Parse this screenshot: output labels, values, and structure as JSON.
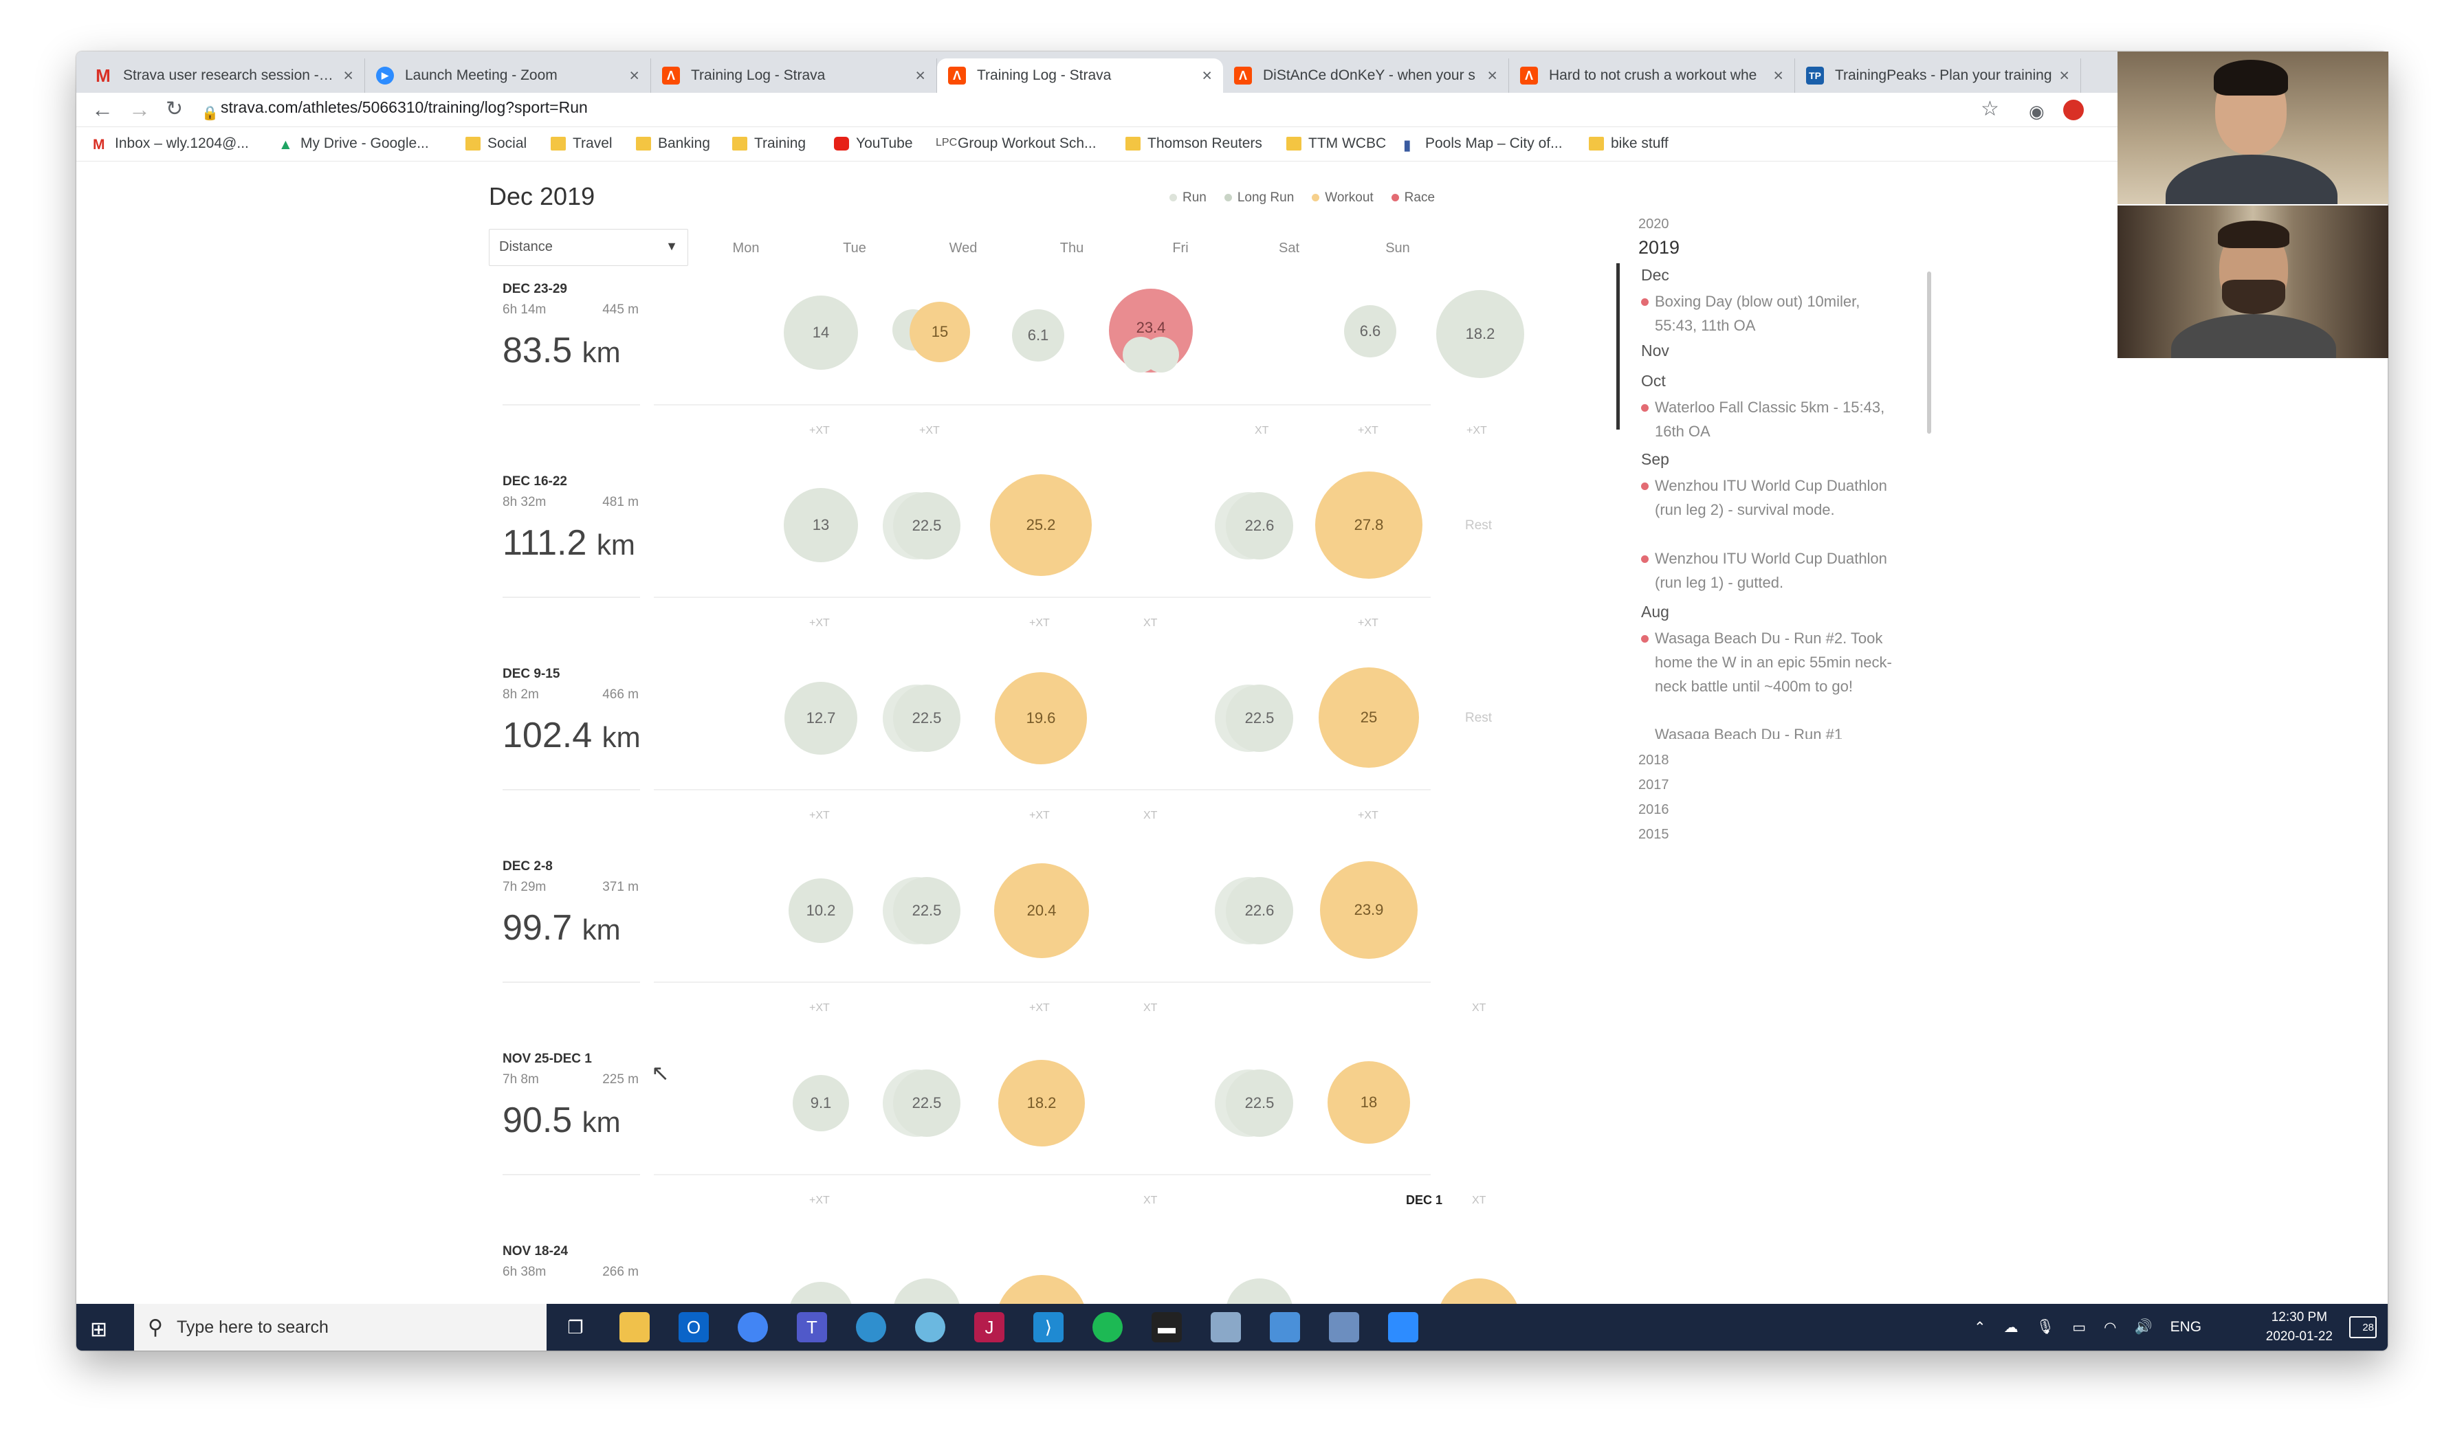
{
  "browser": {
    "tabs": [
      {
        "title": "Strava user research session - Co",
        "icon": "gmail-icon",
        "color": "#d93025",
        "glyph": "M"
      },
      {
        "title": "Launch Meeting - Zoom",
        "icon": "zoom-icon",
        "color": "#2d8cff",
        "glyph": "▶"
      },
      {
        "title": "Training Log - Strava",
        "icon": "strava-icon",
        "color": "#fc4c02",
        "glyph": "Λ"
      },
      {
        "title": "Training Log - Strava",
        "icon": "strava-icon",
        "color": "#fc4c02",
        "glyph": "Λ",
        "active": true
      },
      {
        "title": "DiStAnCe dOnKeY - when your s",
        "icon": "strava-icon",
        "color": "#fc4c02",
        "glyph": "Λ"
      },
      {
        "title": "Hard to not crush a workout whe",
        "icon": "strava-icon",
        "color": "#fc4c02",
        "glyph": "Λ"
      },
      {
        "title": "TrainingPeaks - Plan your training",
        "icon": "trainingpeaks-icon",
        "color": "#1a5faa",
        "glyph": "TP"
      }
    ],
    "close_glyph": "×",
    "url": "strava.com/athletes/5066310/training/log?sport=Run",
    "bookmarks": [
      "Inbox – wly.1204@...",
      "My Drive - Google...",
      "Social",
      "Travel",
      "Banking",
      "Training",
      "YouTube",
      "Group Workout Sch...",
      "Thomson Reuters",
      "TTM WCBC",
      "Pools Map – City of...",
      "bike stuff"
    ]
  },
  "log": {
    "month_title": "Dec 2019",
    "legend": [
      {
        "label": "Run",
        "color": "#dde3da"
      },
      {
        "label": "Long Run",
        "color": "#c9d4c6"
      },
      {
        "label": "Workout",
        "color": "#f6d08c"
      },
      {
        "label": "Race",
        "color": "#e36b73"
      }
    ],
    "metric_select": "Distance",
    "days": [
      "Mon",
      "Tue",
      "Wed",
      "Thu",
      "Fri",
      "Sat",
      "Sun"
    ],
    "unit": "km",
    "rest_label": "Rest",
    "weeks": [
      {
        "label": "DEC 23-29",
        "time": "6h 14m",
        "elevation": "445 m",
        "distance": "83.5"
      },
      {
        "label": "DEC 16-22",
        "time": "8h 32m",
        "elevation": "481 m",
        "distance": "111.2"
      },
      {
        "label": "DEC 9-15",
        "time": "8h 2m",
        "elevation": "466 m",
        "distance": "102.4"
      },
      {
        "label": "DEC 2-8",
        "time": "7h 29m",
        "elevation": "371 m",
        "distance": "99.7"
      },
      {
        "label": "NOV 25-DEC 1",
        "time": "7h 8m",
        "elevation": "225 m",
        "distance": "90.5"
      },
      {
        "label": "NOV 18-24",
        "time": "6h 38m",
        "elevation": "266 m",
        "distance": ""
      }
    ],
    "activities": [
      [
        "14",
        "15",
        "6.1",
        "23.4",
        "",
        "6.6",
        "18.2"
      ],
      [
        "13",
        "22.5",
        "25.2",
        "",
        "22.6",
        "27.8",
        ""
      ],
      [
        "12.7",
        "22.5",
        "19.6",
        "",
        "22.5",
        "25",
        ""
      ],
      [
        "10.2",
        "22.5",
        "20.4",
        "",
        "22.6",
        "23.9",
        ""
      ],
      [
        "9.1",
        "22.5",
        "18.2",
        "",
        "22.5",
        "18",
        ""
      ]
    ],
    "xt_labels": [
      [
        "+XT",
        "+XT",
        "",
        "",
        "XT",
        "+XT",
        "+XT"
      ],
      [
        "+XT",
        "",
        "+XT",
        "XT",
        "",
        "+XT",
        ""
      ],
      [
        "+XT",
        "",
        "+XT",
        "XT",
        "",
        "+XT",
        ""
      ],
      [
        "+XT",
        "",
        "+XT",
        "XT",
        "",
        "",
        "XT"
      ],
      [
        "+XT",
        "",
        "",
        "XT",
        "",
        "",
        "XT"
      ]
    ],
    "dec1_label": "DEC 1"
  },
  "sidebar": {
    "year_prev": "2020",
    "year_current": "2019",
    "months": [
      {
        "name": "Dec",
        "events": [
          "Boxing Day (blow out) 10miler, 55:43, 11th OA"
        ]
      },
      {
        "name": "Nov",
        "events": []
      },
      {
        "name": "Oct",
        "events": [
          "Waterloo Fall Classic 5km - 15:43, 16th OA"
        ]
      },
      {
        "name": "Sep",
        "events": [
          "Wenzhou ITU World Cup Duathlon (run leg 2) - survival mode.",
          "Wenzhou ITU World Cup Duathlon (run leg 1) - gutted."
        ]
      },
      {
        "name": "Aug",
        "events": [
          "Wasaga Beach Du - Run #2. Took home the W in an epic 55min neck-neck battle until ~400m to go!",
          "Wasaga Beach Du - Run #1"
        ]
      }
    ],
    "older_years": [
      "2018",
      "2017",
      "2016",
      "2015"
    ]
  },
  "taskbar": {
    "search_placeholder": "Type here to search",
    "language": "ENG",
    "time": "12:30 PM",
    "date": "2020-01-22",
    "notifications": "28"
  }
}
